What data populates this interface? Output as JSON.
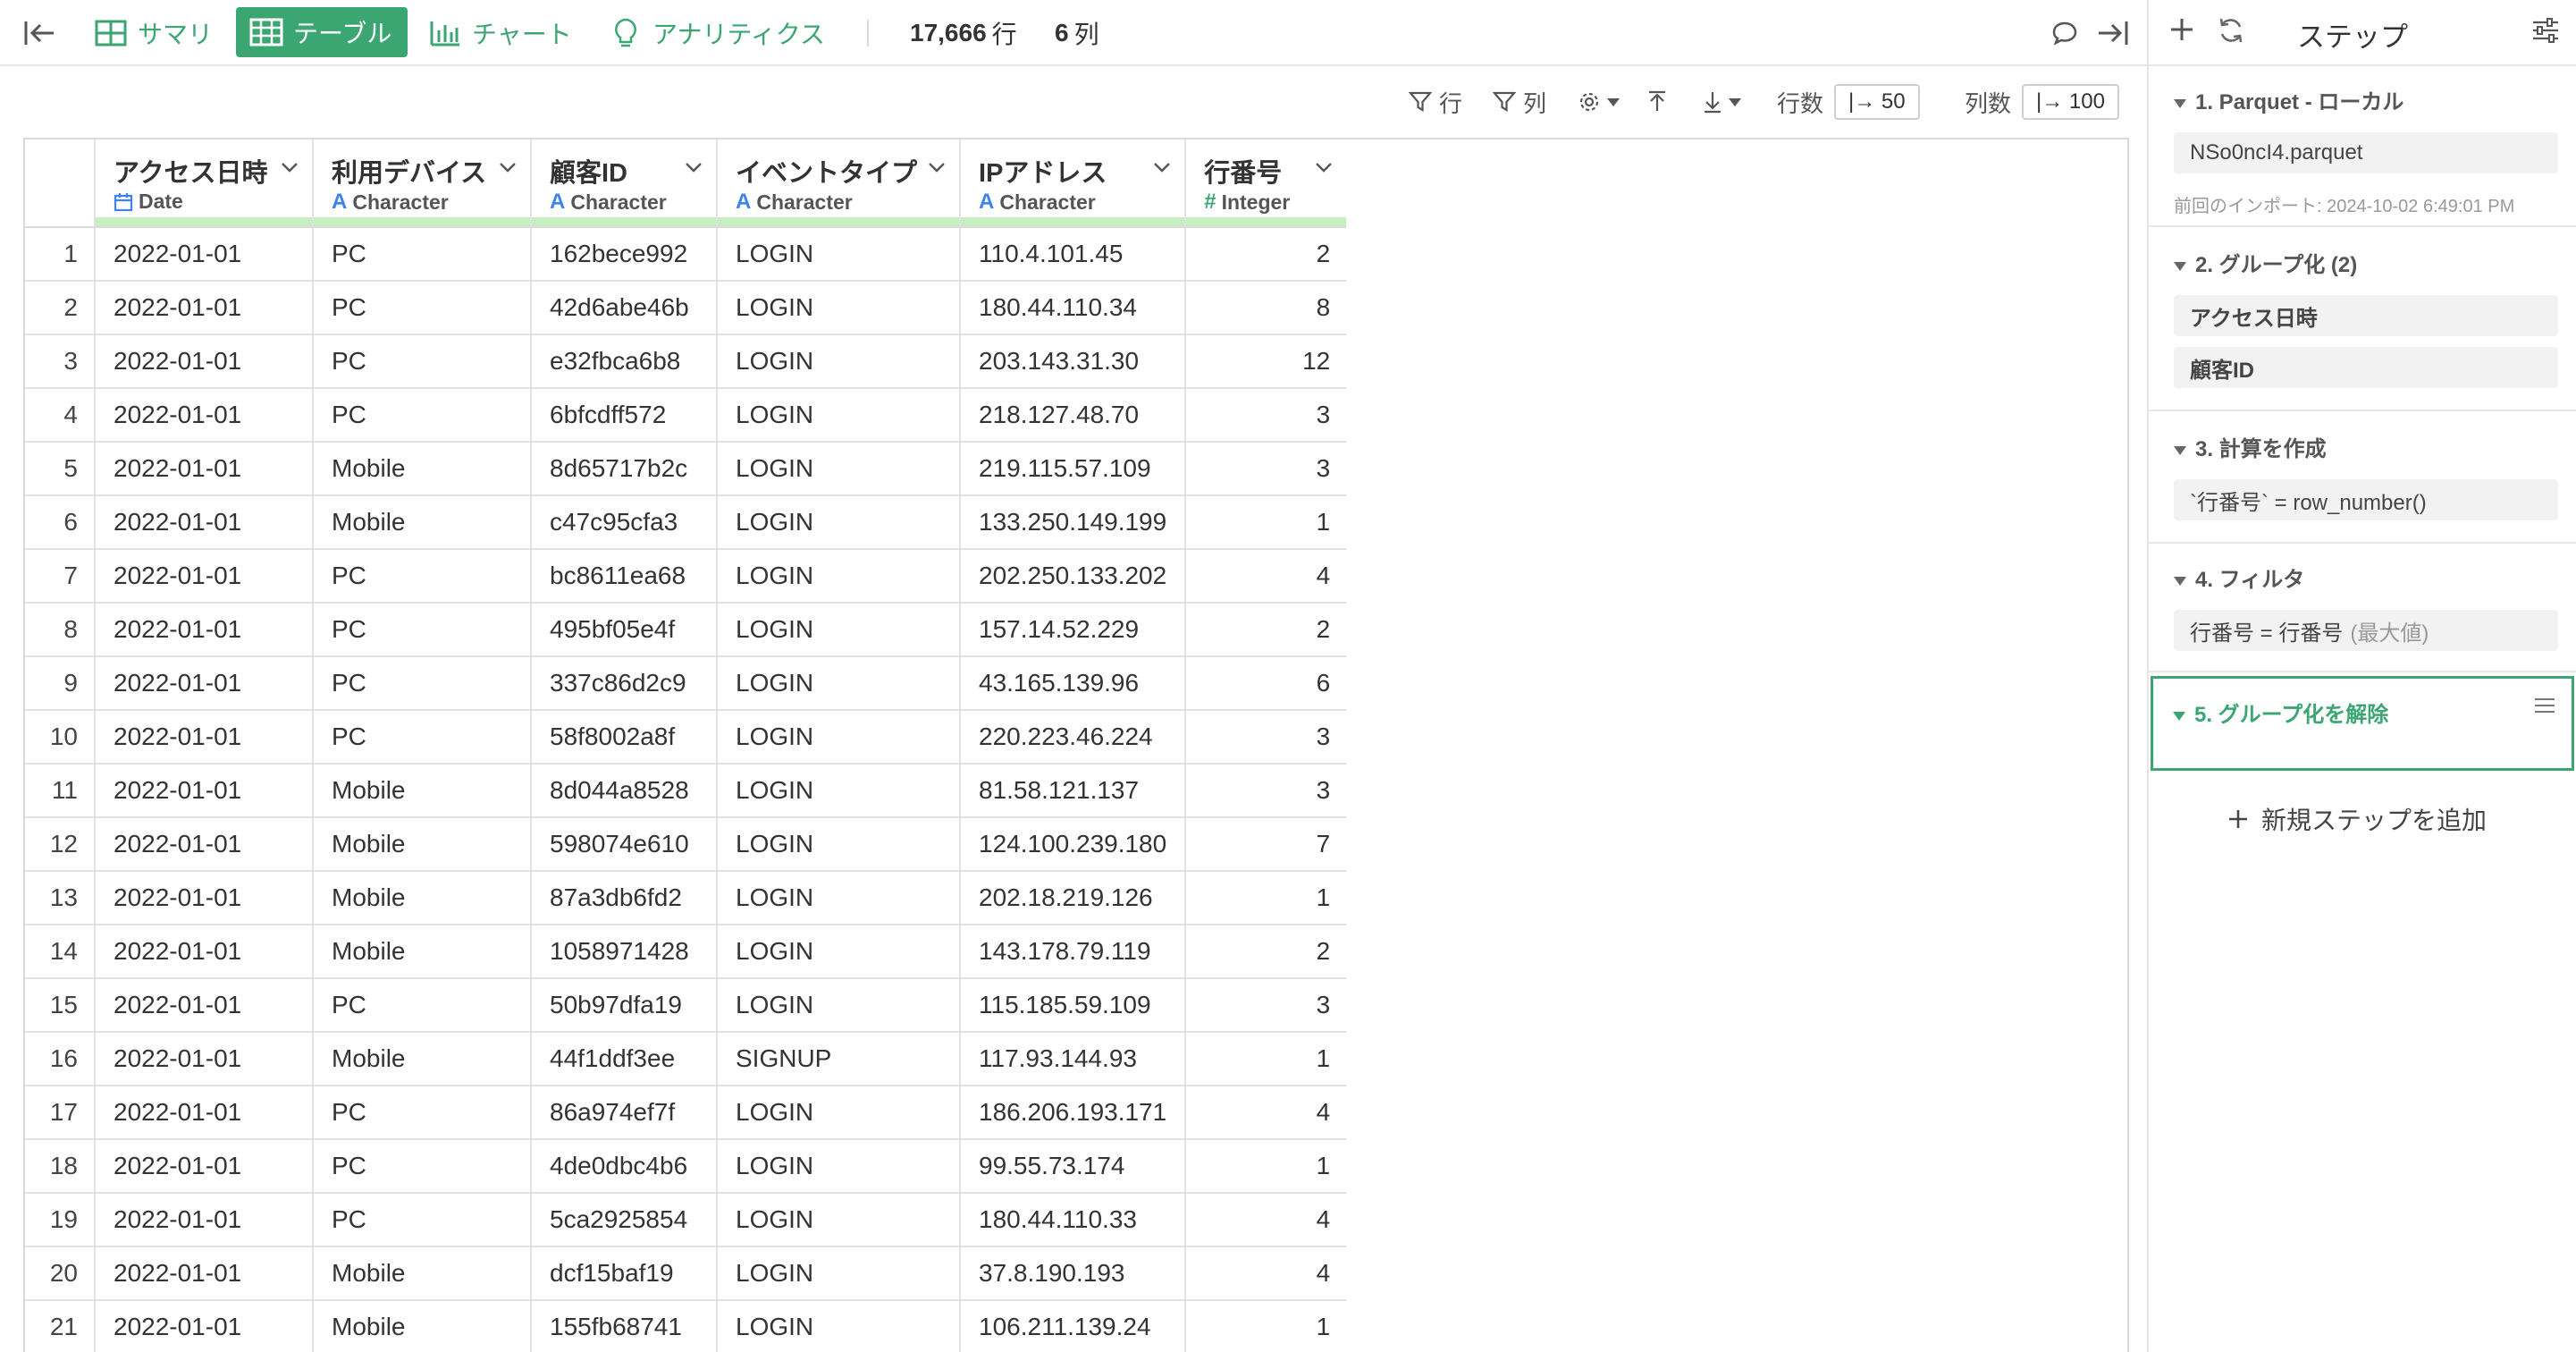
{
  "topbar": {
    "tabs": [
      {
        "label": "サマリ",
        "icon": "summary-grid-icon"
      },
      {
        "label": "テーブル",
        "icon": "table-icon",
        "active": true
      },
      {
        "label": "チャート",
        "icon": "bar-chart-icon"
      },
      {
        "label": "アナリティクス",
        "icon": "lightbulb-icon"
      }
    ],
    "row_count": "17,666",
    "row_unit": "行",
    "col_count": "6",
    "col_unit": "列",
    "accent_color": "#3ba671"
  },
  "toolbar": {
    "row_filter_label": "行",
    "col_filter_label": "列",
    "rows_label": "行数",
    "rows_value": "|→ 50",
    "cols_label": "列数",
    "cols_value": "|→ 100"
  },
  "table": {
    "columns": [
      {
        "name": "アクセス日時",
        "type": "Date",
        "type_icon": "calendar-icon"
      },
      {
        "name": "利用デバイス",
        "type": "Character",
        "type_icon": "A"
      },
      {
        "name": "顧客ID",
        "type": "Character",
        "type_icon": "A"
      },
      {
        "name": "イベントタイプ",
        "type": "Character",
        "type_icon": "A"
      },
      {
        "name": "IPアドレス",
        "type": "Character",
        "type_icon": "A"
      },
      {
        "name": "行番号",
        "type": "Integer",
        "type_icon": "#"
      }
    ],
    "rows": [
      [
        "1",
        "2022-01-01",
        "PC",
        "162bece992",
        "LOGIN",
        "110.4.101.45",
        "2"
      ],
      [
        "2",
        "2022-01-01",
        "PC",
        "42d6abe46b",
        "LOGIN",
        "180.44.110.34",
        "8"
      ],
      [
        "3",
        "2022-01-01",
        "PC",
        "e32fbca6b8",
        "LOGIN",
        "203.143.31.30",
        "12"
      ],
      [
        "4",
        "2022-01-01",
        "PC",
        "6bfcdff572",
        "LOGIN",
        "218.127.48.70",
        "3"
      ],
      [
        "5",
        "2022-01-01",
        "Mobile",
        "8d65717b2c",
        "LOGIN",
        "219.115.57.109",
        "3"
      ],
      [
        "6",
        "2022-01-01",
        "Mobile",
        "c47c95cfa3",
        "LOGIN",
        "133.250.149.199",
        "1"
      ],
      [
        "7",
        "2022-01-01",
        "PC",
        "bc8611ea68",
        "LOGIN",
        "202.250.133.202",
        "4"
      ],
      [
        "8",
        "2022-01-01",
        "PC",
        "495bf05e4f",
        "LOGIN",
        "157.14.52.229",
        "2"
      ],
      [
        "9",
        "2022-01-01",
        "PC",
        "337c86d2c9",
        "LOGIN",
        "43.165.139.96",
        "6"
      ],
      [
        "10",
        "2022-01-01",
        "PC",
        "58f8002a8f",
        "LOGIN",
        "220.223.46.224",
        "3"
      ],
      [
        "11",
        "2022-01-01",
        "Mobile",
        "8d044a8528",
        "LOGIN",
        "81.58.121.137",
        "3"
      ],
      [
        "12",
        "2022-01-01",
        "Mobile",
        "598074e610",
        "LOGIN",
        "124.100.239.180",
        "7"
      ],
      [
        "13",
        "2022-01-01",
        "Mobile",
        "87a3db6fd2",
        "LOGIN",
        "202.18.219.126",
        "1"
      ],
      [
        "14",
        "2022-01-01",
        "Mobile",
        "1058971428",
        "LOGIN",
        "143.178.79.119",
        "2"
      ],
      [
        "15",
        "2022-01-01",
        "PC",
        "50b97dfa19",
        "LOGIN",
        "115.185.59.109",
        "3"
      ],
      [
        "16",
        "2022-01-01",
        "Mobile",
        "44f1ddf3ee",
        "SIGNUP",
        "117.93.144.93",
        "1"
      ],
      [
        "17",
        "2022-01-01",
        "PC",
        "86a974ef7f",
        "LOGIN",
        "186.206.193.171",
        "4"
      ],
      [
        "18",
        "2022-01-01",
        "PC",
        "4de0dbc4b6",
        "LOGIN",
        "99.55.73.174",
        "1"
      ],
      [
        "19",
        "2022-01-01",
        "PC",
        "5ca2925854",
        "LOGIN",
        "180.44.110.33",
        "4"
      ],
      [
        "20",
        "2022-01-01",
        "Mobile",
        "dcf15baf19",
        "LOGIN",
        "37.8.190.193",
        "4"
      ],
      [
        "21",
        "2022-01-01",
        "Mobile",
        "155fb68741",
        "LOGIN",
        "106.211.139.24",
        "1"
      ]
    ]
  },
  "steps": {
    "title": "ステップ",
    "items": [
      {
        "title": "1. Parquet - ローカル",
        "box": "NSo0ncI4.parquet",
        "sub": "前回のインポート: 2024-10-02 6:49:01 PM"
      },
      {
        "title": "2. グループ化 (2)",
        "boxes": [
          "アクセス日時",
          "顧客ID"
        ]
      },
      {
        "title": "3. 計算を作成",
        "box": "`行番号` = row_number()"
      },
      {
        "title": "4. フィルタ",
        "box": "行番号 = 行番号",
        "box_muted": "(最大値)"
      },
      {
        "title": "5. グループ化を解除",
        "selected": true
      }
    ],
    "add_label": "新規ステップを追加"
  }
}
